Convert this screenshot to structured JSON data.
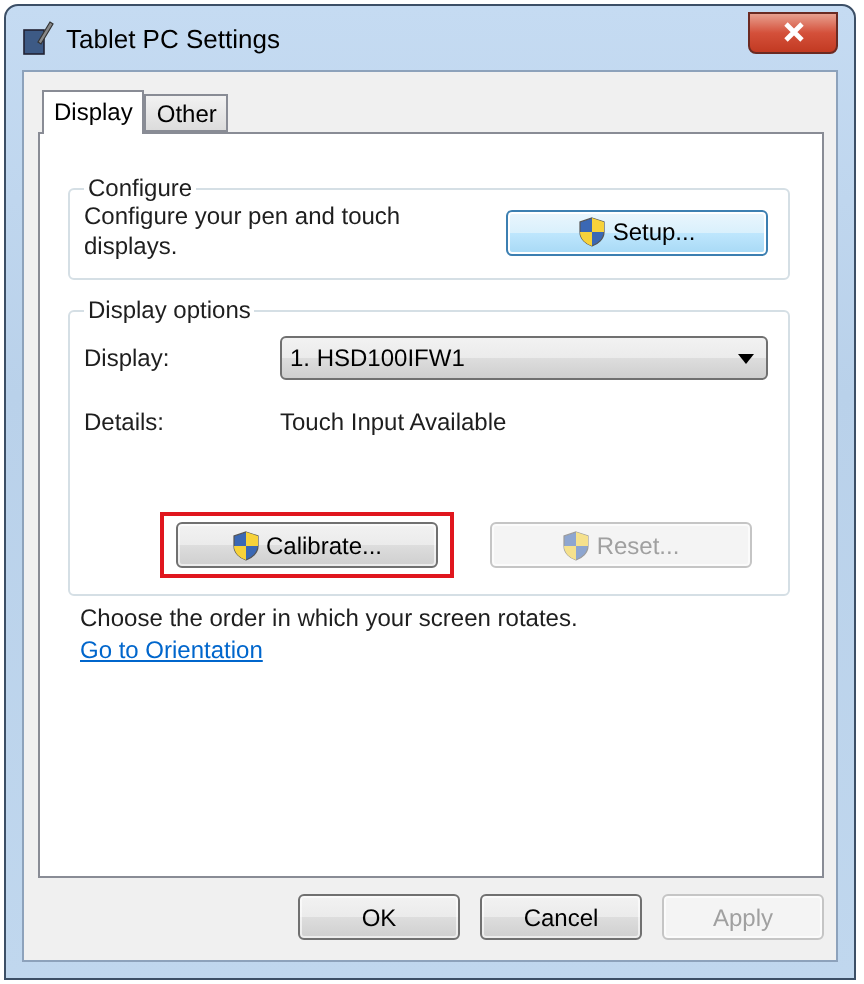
{
  "window": {
    "title": "Tablet PC Settings"
  },
  "tabs": [
    {
      "label": "Display",
      "selected": true
    },
    {
      "label": "Other",
      "selected": false
    }
  ],
  "configure": {
    "title": "Configure",
    "description": "Configure your pen and touch displays.",
    "button": {
      "label": "Setup...",
      "disabled": false
    }
  },
  "display_options": {
    "title": "Display options",
    "display_label": "Display:",
    "display_value": "1. HSD100IFW1",
    "details_label": "Details:",
    "details_value": "Touch Input Available",
    "buttons": [
      {
        "label": "Calibrate...",
        "disabled": false,
        "highlighted": true
      },
      {
        "label": "Reset...",
        "disabled": true,
        "highlighted": false
      }
    ]
  },
  "orientation": {
    "text": "Choose the order in which your screen rotates.",
    "link": "Go to Orientation"
  },
  "buttons": [
    {
      "label": "OK",
      "disabled": false
    },
    {
      "label": "Cancel",
      "disabled": false
    },
    {
      "label": "Apply",
      "disabled": true
    }
  ]
}
